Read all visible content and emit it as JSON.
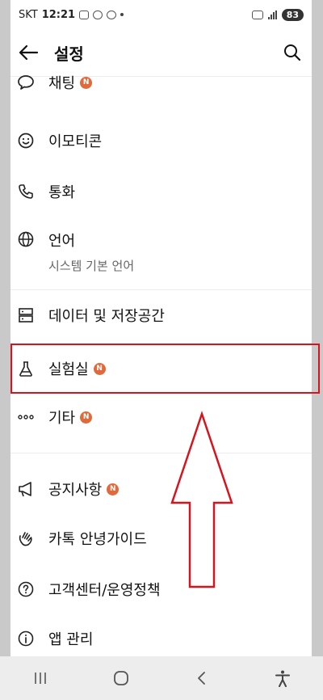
{
  "statusbar": {
    "carrier": "SKT",
    "time": "12:21",
    "battery": "83"
  },
  "header": {
    "title": "설정"
  },
  "items": [
    {
      "label": "채팅",
      "badge": "N"
    },
    {
      "label": "이모티콘"
    },
    {
      "label": "통화"
    },
    {
      "label": "언어",
      "sub": "시스템 기본 언어"
    },
    {
      "label": "데이터 및 저장공간"
    },
    {
      "label": "실험실",
      "badge": "N"
    },
    {
      "label": "기타",
      "badge": "N"
    },
    {
      "label": "공지사항",
      "badge": "N"
    },
    {
      "label": "카톡 안녕가이드"
    },
    {
      "label": "고객센터/운영정책"
    },
    {
      "label": "앱 관리"
    }
  ],
  "colors": {
    "accent": "#d7141e",
    "badge": "#e06a3b"
  },
  "icons": [
    "back-arrow-icon",
    "search-icon",
    "chat-bubble-icon",
    "emoticon-icon",
    "phone-icon",
    "globe-icon",
    "storage-icon",
    "flask-icon",
    "more-icon",
    "megaphone-icon",
    "wave-hand-icon",
    "help-icon",
    "info-icon"
  ]
}
